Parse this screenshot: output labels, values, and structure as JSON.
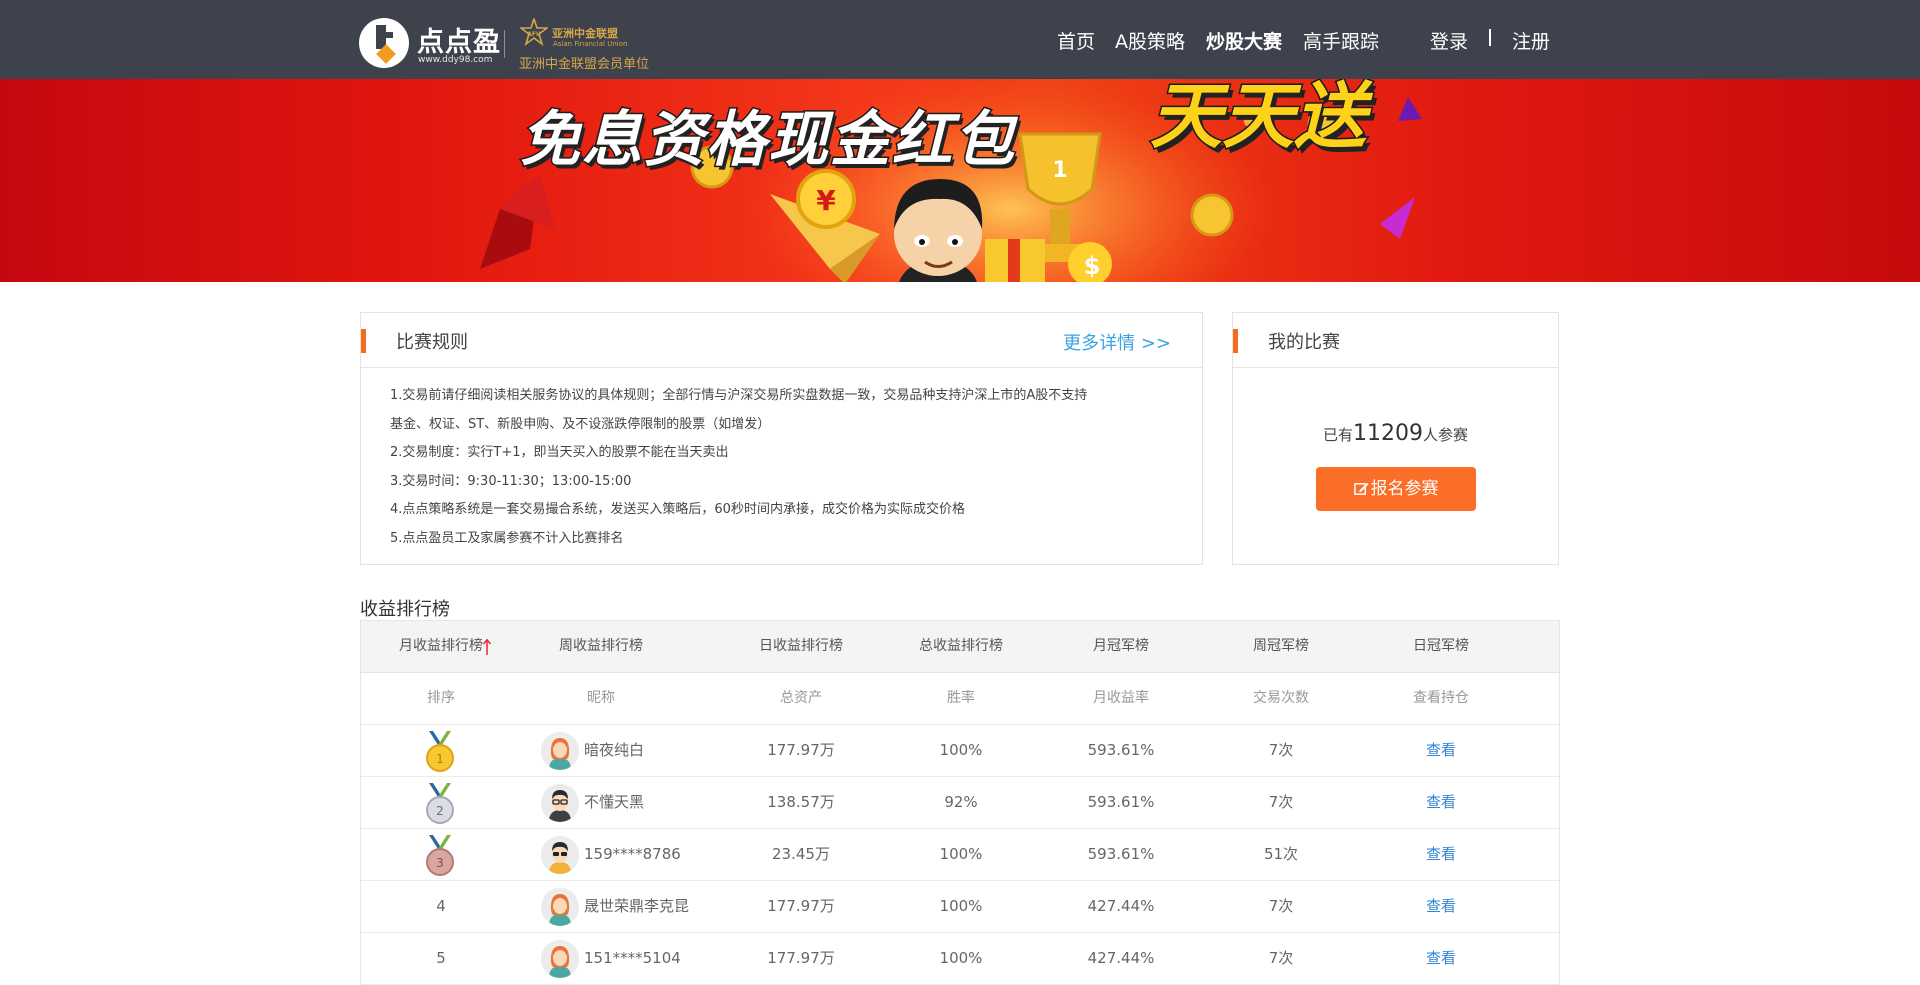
{
  "header": {
    "brand_name": "点点盈",
    "brand_url": "www.ddy98.com",
    "afu_name": "亚洲中金联盟",
    "afu_english": "Asian Financial Union",
    "afu_member": "亚洲中金联盟会员单位",
    "nav": [
      "首页",
      "A股策略",
      "炒股大赛",
      "高手跟踪"
    ],
    "active_nav": "炒股大赛",
    "login": "登录",
    "register": "注册"
  },
  "banner": {
    "headline": "免息资格现金红包",
    "headline_highlight": "天天送"
  },
  "rules_card": {
    "title": "比赛规则",
    "more": "更多详情 >>",
    "lines": [
      "1.交易前请仔细阅读相关服务协议的具体规则；全部行情与沪深交易所实盘数据一致，交易品种支持沪深上市的A股不支持",
      "基金、权证、ST、新股申购、及不设涨跌停限制的股票（如增发）",
      "2.交易制度：实行T+1，即当天买入的股票不能在当天卖出",
      "3.交易时间：9:30-11:30；13:00-15:00",
      "4.点点策略系统是一套交易撮合系统，发送买入策略后，60秒时间内承接，成交价格为实际成交价格",
      "5.点点盈员工及家属参赛不计入比赛排名"
    ]
  },
  "my_contest": {
    "title": "我的比赛",
    "prefix": "已有",
    "count": "11209",
    "suffix": "人参赛",
    "join_button": "报名参赛"
  },
  "leaderboard": {
    "title": "收益排行榜",
    "tabs": [
      "月收益排行榜",
      "周收益排行榜",
      "日收益排行榜",
      "总收益排行榜",
      "月冠军榜",
      "周冠军榜",
      "日冠军榜"
    ],
    "active_tab": "月收益排行榜",
    "columns": [
      "排序",
      "昵称",
      "总资产",
      "胜率",
      "月收益率",
      "交易次数",
      "查看持仓"
    ],
    "rows": [
      {
        "rank": "1",
        "name": "暗夜纯白",
        "assets": "177.97万",
        "win_rate": "100%",
        "return": "593.61%",
        "trades": "7次",
        "action": "查看",
        "avatar": "female"
      },
      {
        "rank": "2",
        "name": "不懂天黑",
        "assets": "138.57万",
        "win_rate": "92%",
        "return": "593.61%",
        "trades": "7次",
        "action": "查看",
        "avatar": "male"
      },
      {
        "rank": "3",
        "name": "159****8786",
        "assets": "23.45万",
        "win_rate": "100%",
        "return": "593.61%",
        "trades": "51次",
        "action": "查看",
        "avatar": "male"
      },
      {
        "rank": "4",
        "name": "晟世荣鼎李克昆",
        "assets": "177.97万",
        "win_rate": "100%",
        "return": "427.44%",
        "trades": "7次",
        "action": "查看",
        "avatar": "female"
      },
      {
        "rank": "5",
        "name": "151****5104",
        "assets": "177.97万",
        "win_rate": "100%",
        "return": "427.44%",
        "trades": "7次",
        "action": "查看",
        "avatar": "female"
      }
    ]
  },
  "colors": {
    "header_bg": "#3d424c",
    "accent_orange": "#fb6e27",
    "link_blue": "#2f86d4",
    "afu_gold": "#d7a64a",
    "banner_red": "#e2170e"
  }
}
